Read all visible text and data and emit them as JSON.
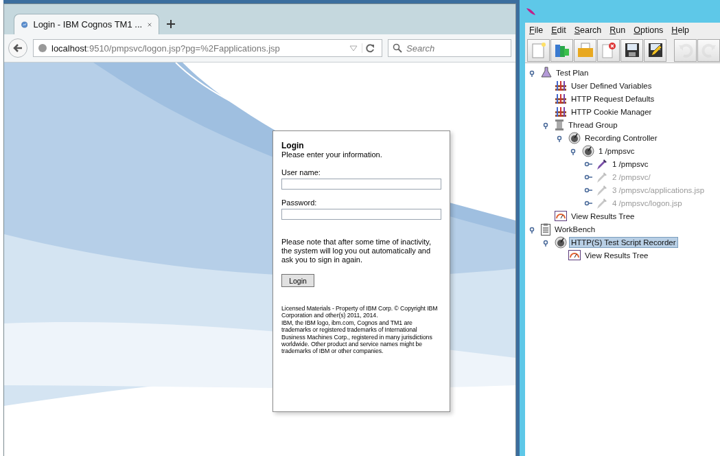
{
  "browser": {
    "tab": {
      "title": "Login - IBM Cognos TM1 ...",
      "selected": true
    },
    "address": {
      "host": "localhost",
      "rest": ":9510/pmpsvc/logon.jsp?pg=%2Fapplications.jsp"
    },
    "search": {
      "placeholder": "Search"
    }
  },
  "login": {
    "title": "Login",
    "subtitle": "Please enter your information.",
    "username_label": "User name:",
    "password_label": "Password:",
    "note": "Please note that after some time of inactivity, the system will log you out automatically and ask you to sign in again.",
    "button": "Login",
    "legal": [
      "Licensed Materials - Property of IBM Corp. © Copyright IBM Corporation and other(s) 2011, 2014.",
      "IBM, the IBM logo, ibm.com, Cognos and TM1 are trademarks or registered trademarks of International Business Machines Corp., registered in many jurisdictions worldwide. Other product and service names might be trademarks of IBM or other companies."
    ]
  },
  "jmeter": {
    "menu": [
      {
        "label": "File"
      },
      {
        "label": "Edit"
      },
      {
        "label": "Search"
      },
      {
        "label": "Run"
      },
      {
        "label": "Options"
      },
      {
        "label": "Help"
      }
    ],
    "toolbar": [
      {
        "kind": "new",
        "disabled": false
      },
      {
        "kind": "templates",
        "disabled": false
      },
      {
        "kind": "open",
        "disabled": false
      },
      {
        "kind": "close",
        "disabled": false
      },
      {
        "kind": "save",
        "disabled": false
      },
      {
        "kind": "saveas",
        "disabled": false
      },
      {
        "kind": "undo",
        "disabled": true
      },
      {
        "kind": "redo",
        "disabled": true
      }
    ],
    "tree": [
      {
        "label": "Test Plan",
        "kind": "plan",
        "expanded": true,
        "disabled": false,
        "selected": false,
        "children": [
          {
            "label": "User Defined Variables",
            "kind": "config",
            "disabled": false,
            "selected": false
          },
          {
            "label": "HTTP Request Defaults",
            "kind": "config",
            "disabled": false,
            "selected": false
          },
          {
            "label": "HTTP Cookie Manager",
            "kind": "config",
            "disabled": false,
            "selected": false
          },
          {
            "label": "Thread Group",
            "kind": "thread",
            "expanded": true,
            "disabled": false,
            "selected": false,
            "children": [
              {
                "label": "Recording Controller",
                "kind": "controller",
                "expanded": true,
                "disabled": false,
                "selected": false,
                "children": [
                  {
                    "label": "1 /pmpsvc",
                    "kind": "controller",
                    "expanded": true,
                    "disabled": false,
                    "selected": false,
                    "children": [
                      {
                        "label": "1 /pmpsvc",
                        "kind": "sampler",
                        "expanded": false,
                        "disabled": false,
                        "selected": false
                      },
                      {
                        "label": "2 /pmpsvc/",
                        "kind": "sampler",
                        "expanded": false,
                        "disabled": true,
                        "selected": false
                      },
                      {
                        "label": "3 /pmpsvc/applications.jsp",
                        "kind": "sampler",
                        "expanded": false,
                        "disabled": true,
                        "selected": false
                      },
                      {
                        "label": "4 /pmpsvc/logon.jsp",
                        "kind": "sampler",
                        "expanded": false,
                        "disabled": true,
                        "selected": false
                      }
                    ]
                  }
                ]
              }
            ]
          },
          {
            "label": "View Results Tree",
            "kind": "listener",
            "disabled": false,
            "selected": false
          }
        ]
      },
      {
        "label": "WorkBench",
        "kind": "workbench",
        "expanded": true,
        "disabled": false,
        "selected": false,
        "children": [
          {
            "label": "HTTP(S) Test Script Recorder",
            "kind": "recorder",
            "expanded": true,
            "disabled": false,
            "selected": true,
            "children": [
              {
                "label": "View Results Tree",
                "kind": "listener",
                "disabled": false,
                "selected": false
              }
            ]
          }
        ]
      }
    ]
  }
}
